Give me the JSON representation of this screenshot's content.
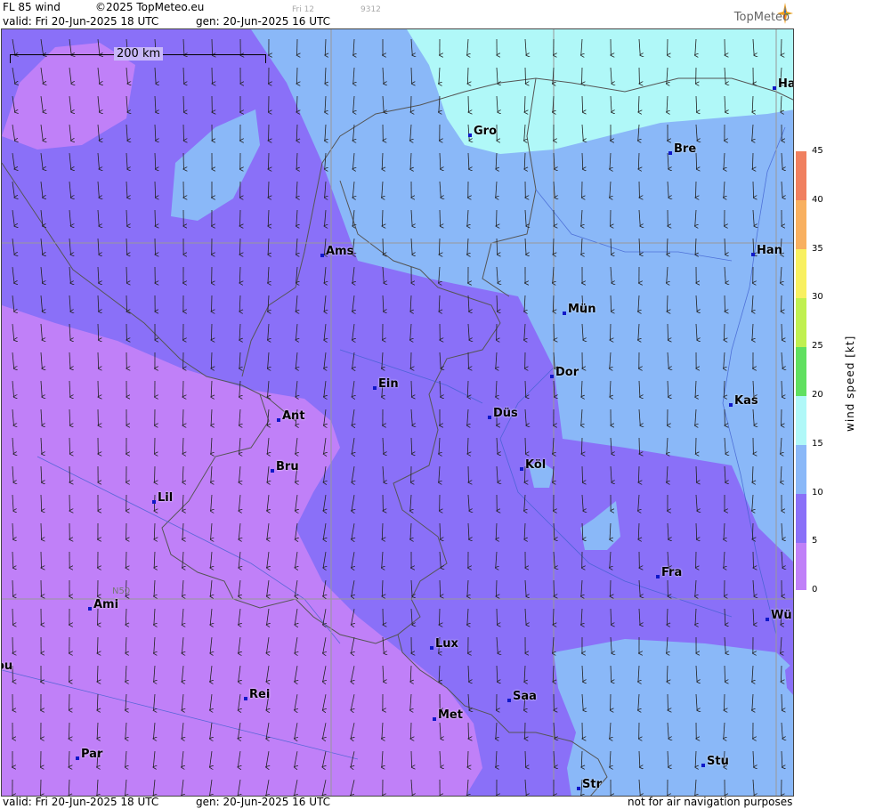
{
  "header": {
    "product": "FL 85 wind",
    "copyright": "©2025 TopMeteo.eu",
    "small_label": "Fri 12",
    "small_code": "9312",
    "valid": "valid:  Fri  20-Jun-2025  18 UTC",
    "gen": "gen: 20-Jun-2025 16 UTC",
    "logo": "TopMeteo"
  },
  "footer": {
    "valid": "valid:  Fri  20-Jun-2025  18 UTC",
    "gen": "gen: 20-Jun-2025 16 UTC",
    "disclaimer": "not for air navigation purposes"
  },
  "map": {
    "scale_label": "200 km",
    "grid_label": "N50",
    "cities": [
      {
        "name": "Ha"
      },
      {
        "name": "Gro"
      },
      {
        "name": "Bre"
      },
      {
        "name": "Ams"
      },
      {
        "name": "Han"
      },
      {
        "name": "Mün"
      },
      {
        "name": "Dor"
      },
      {
        "name": "Ein"
      },
      {
        "name": "Kas"
      },
      {
        "name": "Ant"
      },
      {
        "name": "Düs"
      },
      {
        "name": "Bru"
      },
      {
        "name": "Köl"
      },
      {
        "name": "Lil"
      },
      {
        "name": "Fra"
      },
      {
        "name": "Ami"
      },
      {
        "name": "Wü"
      },
      {
        "name": "Lux"
      },
      {
        "name": "Rei"
      },
      {
        "name": "Saa"
      },
      {
        "name": "Met"
      },
      {
        "name": "Par"
      },
      {
        "name": "Stu"
      },
      {
        "name": "Str"
      },
      {
        "name": "ou"
      }
    ]
  },
  "legend": {
    "title": "wind  speed  [kt]",
    "ticks": [
      "45",
      "40",
      "35",
      "30",
      "25",
      "20",
      "15",
      "10",
      "5",
      "0"
    ],
    "colors": [
      "#c080f8",
      "#8a70f8",
      "#8ab8f8",
      "#b0f8f8",
      "#80f080",
      "#e0f060",
      "#f8c060",
      "#f06060"
    ]
  }
}
